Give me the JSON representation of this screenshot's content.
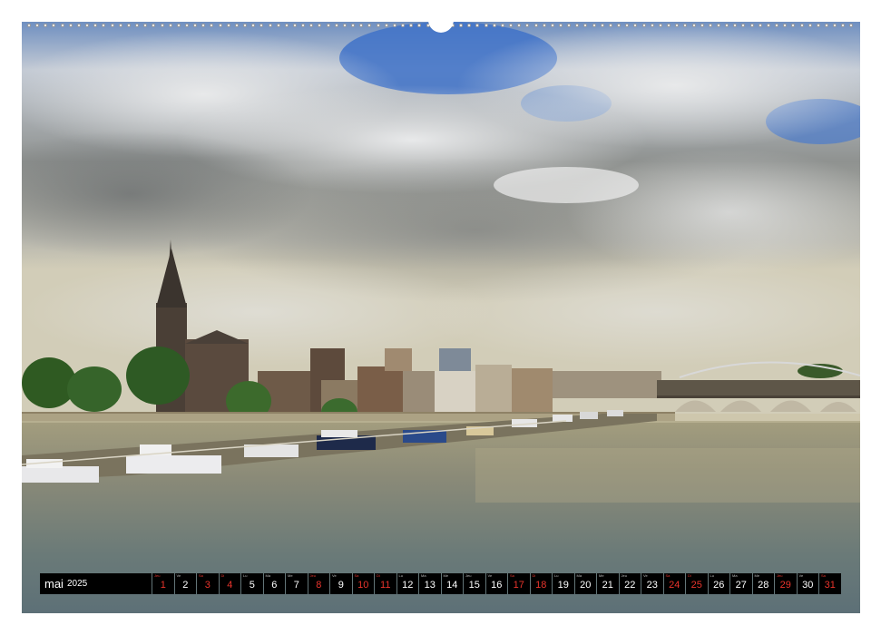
{
  "calendar": {
    "month": "mai",
    "year": "2025",
    "days": [
      {
        "wd": "Jeu",
        "n": "1",
        "red": true
      },
      {
        "wd": "Ve",
        "n": "2",
        "red": false
      },
      {
        "wd": "Sa",
        "n": "3",
        "red": true
      },
      {
        "wd": "Di",
        "n": "4",
        "red": true
      },
      {
        "wd": "Lu",
        "n": "5",
        "red": false
      },
      {
        "wd": "Ma",
        "n": "6",
        "red": false
      },
      {
        "wd": "Me",
        "n": "7",
        "red": false
      },
      {
        "wd": "Jeu",
        "n": "8",
        "red": true
      },
      {
        "wd": "Ve",
        "n": "9",
        "red": false
      },
      {
        "wd": "Sa",
        "n": "10",
        "red": true
      },
      {
        "wd": "Di",
        "n": "11",
        "red": true
      },
      {
        "wd": "Lu",
        "n": "12",
        "red": false
      },
      {
        "wd": "Ma",
        "n": "13",
        "red": false
      },
      {
        "wd": "Me",
        "n": "14",
        "red": false
      },
      {
        "wd": "Jeu",
        "n": "15",
        "red": false
      },
      {
        "wd": "Ve",
        "n": "16",
        "red": false
      },
      {
        "wd": "Sa",
        "n": "17",
        "red": true
      },
      {
        "wd": "Di",
        "n": "18",
        "red": true
      },
      {
        "wd": "Lu",
        "n": "19",
        "red": false
      },
      {
        "wd": "Ma",
        "n": "20",
        "red": false
      },
      {
        "wd": "Me",
        "n": "21",
        "red": false
      },
      {
        "wd": "Jeu",
        "n": "22",
        "red": false
      },
      {
        "wd": "Ve",
        "n": "23",
        "red": false
      },
      {
        "wd": "Sa",
        "n": "24",
        "red": true
      },
      {
        "wd": "Di",
        "n": "25",
        "red": true
      },
      {
        "wd": "Lu",
        "n": "26",
        "red": false
      },
      {
        "wd": "Ma",
        "n": "27",
        "red": false
      },
      {
        "wd": "Me",
        "n": "28",
        "red": false
      },
      {
        "wd": "Jeu",
        "n": "29",
        "red": true
      },
      {
        "wd": "Ve",
        "n": "30",
        "red": false
      },
      {
        "wd": "Sa",
        "n": "31",
        "red": true
      }
    ]
  },
  "colors": {
    "calendar_bg": "#000000",
    "weekday_text": "#ffffff",
    "holiday_text": "#e8342c"
  }
}
